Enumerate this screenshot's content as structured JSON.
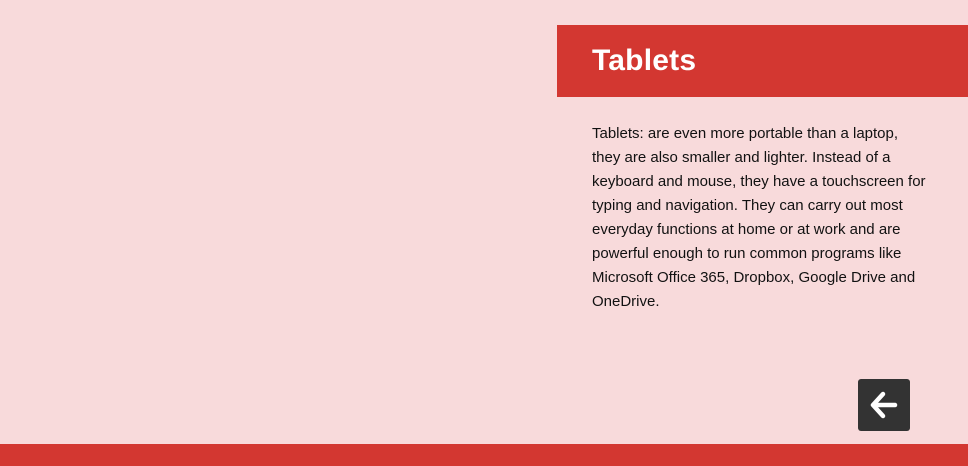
{
  "slide": {
    "title": "Tablets",
    "body": "Tablets: are even more portable than a laptop, they are also smaller and lighter. Instead of a keyboard and mouse, they have a touchscreen for typing and navigation. They can carry out most everyday functions at home or at work and are powerful enough to run common programs like Microsoft Office 365, Dropbox, Google Drive and OneDrive."
  },
  "navigation": {
    "back_icon": "arrow-left-icon"
  },
  "colors": {
    "background": "#f8dadb",
    "accent": "#d33731",
    "button": "#333333",
    "title_text": "#ffffff",
    "body_text": "#111111"
  }
}
